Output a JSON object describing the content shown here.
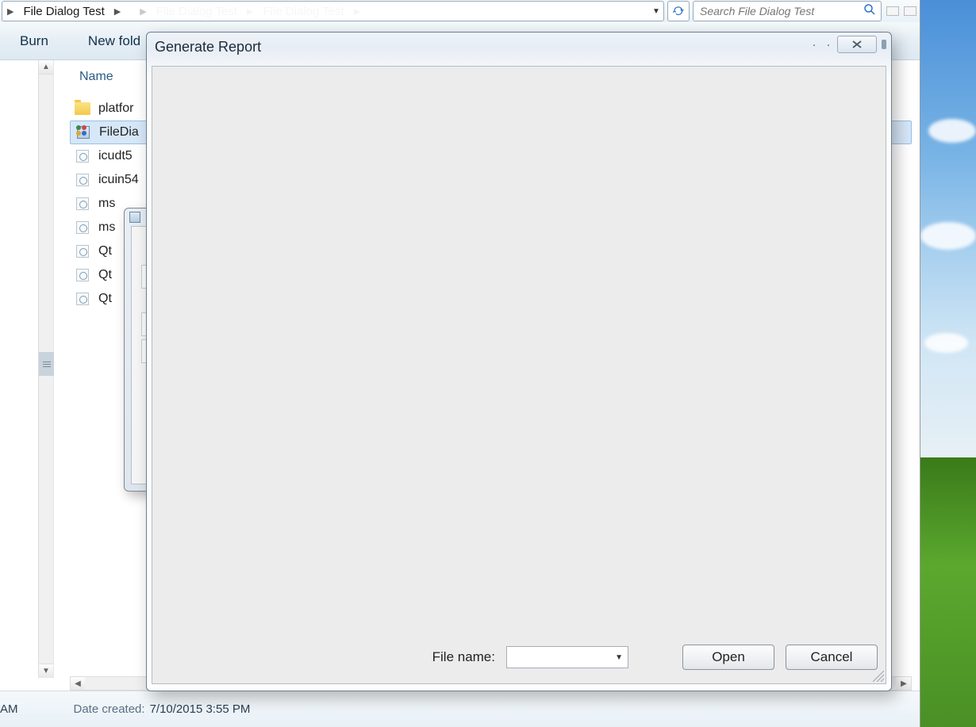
{
  "breadcrumb": {
    "item1": "File Dialog Test",
    "faded2": "File Dialog Test",
    "faded3": "File Dialog Test"
  },
  "search": {
    "placeholder": "Search File Dialog Test"
  },
  "toolbar": {
    "burn": "Burn",
    "newfolder": "New fold"
  },
  "columns": {
    "name": "Name"
  },
  "files": [
    {
      "icon": "folder",
      "name": "platfor"
    },
    {
      "icon": "exe",
      "name": "FileDia",
      "sel": true
    },
    {
      "icon": "dll",
      "name": "icudt5"
    },
    {
      "icon": "dll",
      "name": "icuin54"
    },
    {
      "icon": "dll",
      "name": "ms"
    },
    {
      "icon": "dll",
      "name": "ms"
    },
    {
      "icon": "dll",
      "name": "Qt"
    },
    {
      "icon": "dll",
      "name": "Qt"
    },
    {
      "icon": "dll",
      "name": "Qt"
    }
  ],
  "status": {
    "am": "AM",
    "label": "Date created:",
    "value": "7/10/2015 3:55 PM"
  },
  "modal": {
    "title": "Generate Report",
    "filename_label": "File name:",
    "open": "Open",
    "cancel": "Cancel"
  }
}
